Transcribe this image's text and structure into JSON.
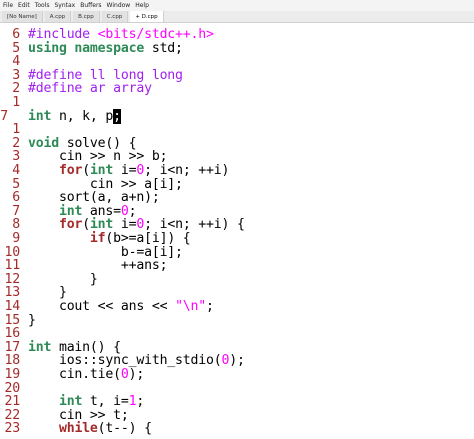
{
  "menu": [
    "File",
    "Edit",
    "Tools",
    "Syntax",
    "Buffers",
    "Window",
    "Help"
  ],
  "tabs": [
    {
      "label": "[No Name]",
      "active": false
    },
    {
      "label": "A.cpp",
      "active": false
    },
    {
      "label": "B.cpp",
      "active": false
    },
    {
      "label": "C.cpp",
      "active": false
    },
    {
      "label": "+ D.cpp",
      "active": true
    }
  ],
  "editor": {
    "cursor_char": ";",
    "lines": [
      {
        "ln": "6",
        "segs": [
          {
            "t": "#include ",
            "c": "pre"
          },
          {
            "t": "<bits/stdc++.h>",
            "c": "str"
          }
        ]
      },
      {
        "ln": "5",
        "segs": [
          {
            "t": "using namespace",
            "c": "type"
          },
          {
            "t": " std;",
            "c": ""
          }
        ]
      },
      {
        "ln": "4",
        "segs": []
      },
      {
        "ln": "3",
        "segs": [
          {
            "t": "#define ll long long",
            "c": "pre"
          }
        ]
      },
      {
        "ln": "2",
        "segs": [
          {
            "t": "#define ar array",
            "c": "pre"
          }
        ]
      },
      {
        "ln": "1",
        "segs": []
      },
      {
        "ln": "7",
        "current": true,
        "segs": [
          {
            "t": "int",
            "c": "type"
          },
          {
            "t": " n, k, p",
            "c": ""
          },
          {
            "t": ";",
            "c": "cursor"
          }
        ]
      },
      {
        "ln": "1",
        "segs": []
      },
      {
        "ln": "2",
        "segs": [
          {
            "t": "void",
            "c": "type"
          },
          {
            "t": " solve() {",
            "c": ""
          }
        ]
      },
      {
        "ln": "3",
        "segs": [
          {
            "t": "    cin >> n >> b;",
            "c": ""
          }
        ]
      },
      {
        "ln": "4",
        "segs": [
          {
            "t": "    ",
            "c": ""
          },
          {
            "t": "for",
            "c": "stmt"
          },
          {
            "t": "(",
            "c": ""
          },
          {
            "t": "int",
            "c": "type"
          },
          {
            "t": " i=",
            "c": ""
          },
          {
            "t": "0",
            "c": "num"
          },
          {
            "t": "; i<n; ++i)",
            "c": ""
          }
        ]
      },
      {
        "ln": "5",
        "segs": [
          {
            "t": "        cin >> a[i];",
            "c": ""
          }
        ]
      },
      {
        "ln": "6",
        "segs": [
          {
            "t": "    sort(a, a+n);",
            "c": ""
          }
        ]
      },
      {
        "ln": "7",
        "segs": [
          {
            "t": "    ",
            "c": ""
          },
          {
            "t": "int",
            "c": "type"
          },
          {
            "t": " ans=",
            "c": ""
          },
          {
            "t": "0",
            "c": "num"
          },
          {
            "t": ";",
            "c": ""
          }
        ]
      },
      {
        "ln": "8",
        "segs": [
          {
            "t": "    ",
            "c": ""
          },
          {
            "t": "for",
            "c": "stmt"
          },
          {
            "t": "(",
            "c": ""
          },
          {
            "t": "int",
            "c": "type"
          },
          {
            "t": " i=",
            "c": ""
          },
          {
            "t": "0",
            "c": "num"
          },
          {
            "t": "; i<n; ++i) {",
            "c": ""
          }
        ]
      },
      {
        "ln": "9",
        "segs": [
          {
            "t": "        ",
            "c": ""
          },
          {
            "t": "if",
            "c": "stmt"
          },
          {
            "t": "(b>=a[i]) {",
            "c": ""
          }
        ]
      },
      {
        "ln": "10",
        "segs": [
          {
            "t": "            b-=a[i];",
            "c": ""
          }
        ]
      },
      {
        "ln": "11",
        "segs": [
          {
            "t": "            ++ans;",
            "c": ""
          }
        ]
      },
      {
        "ln": "12",
        "segs": [
          {
            "t": "        }",
            "c": ""
          }
        ]
      },
      {
        "ln": "13",
        "segs": [
          {
            "t": "    }",
            "c": ""
          }
        ]
      },
      {
        "ln": "14",
        "segs": [
          {
            "t": "    cout << ans << ",
            "c": ""
          },
          {
            "t": "\"\\n\"",
            "c": "str"
          },
          {
            "t": ";",
            "c": ""
          }
        ]
      },
      {
        "ln": "15",
        "segs": [
          {
            "t": "}",
            "c": ""
          }
        ]
      },
      {
        "ln": "16",
        "segs": []
      },
      {
        "ln": "17",
        "segs": [
          {
            "t": "int",
            "c": "type"
          },
          {
            "t": " main() {",
            "c": ""
          }
        ]
      },
      {
        "ln": "18",
        "segs": [
          {
            "t": "    ios::sync_with_stdio(",
            "c": ""
          },
          {
            "t": "0",
            "c": "num"
          },
          {
            "t": ");",
            "c": ""
          }
        ]
      },
      {
        "ln": "19",
        "segs": [
          {
            "t": "    cin.tie(",
            "c": ""
          },
          {
            "t": "0",
            "c": "num"
          },
          {
            "t": ");",
            "c": ""
          }
        ]
      },
      {
        "ln": "20",
        "segs": []
      },
      {
        "ln": "21",
        "segs": [
          {
            "t": "    ",
            "c": ""
          },
          {
            "t": "int",
            "c": "type"
          },
          {
            "t": " t, i=",
            "c": ""
          },
          {
            "t": "1",
            "c": "num"
          },
          {
            "t": ";",
            "c": ""
          }
        ]
      },
      {
        "ln": "22",
        "segs": [
          {
            "t": "    cin >> t;",
            "c": ""
          }
        ]
      },
      {
        "ln": "23",
        "segs": [
          {
            "t": "    ",
            "c": ""
          },
          {
            "t": "while",
            "c": "stmt"
          },
          {
            "t": "(t--) {",
            "c": ""
          }
        ]
      }
    ]
  }
}
